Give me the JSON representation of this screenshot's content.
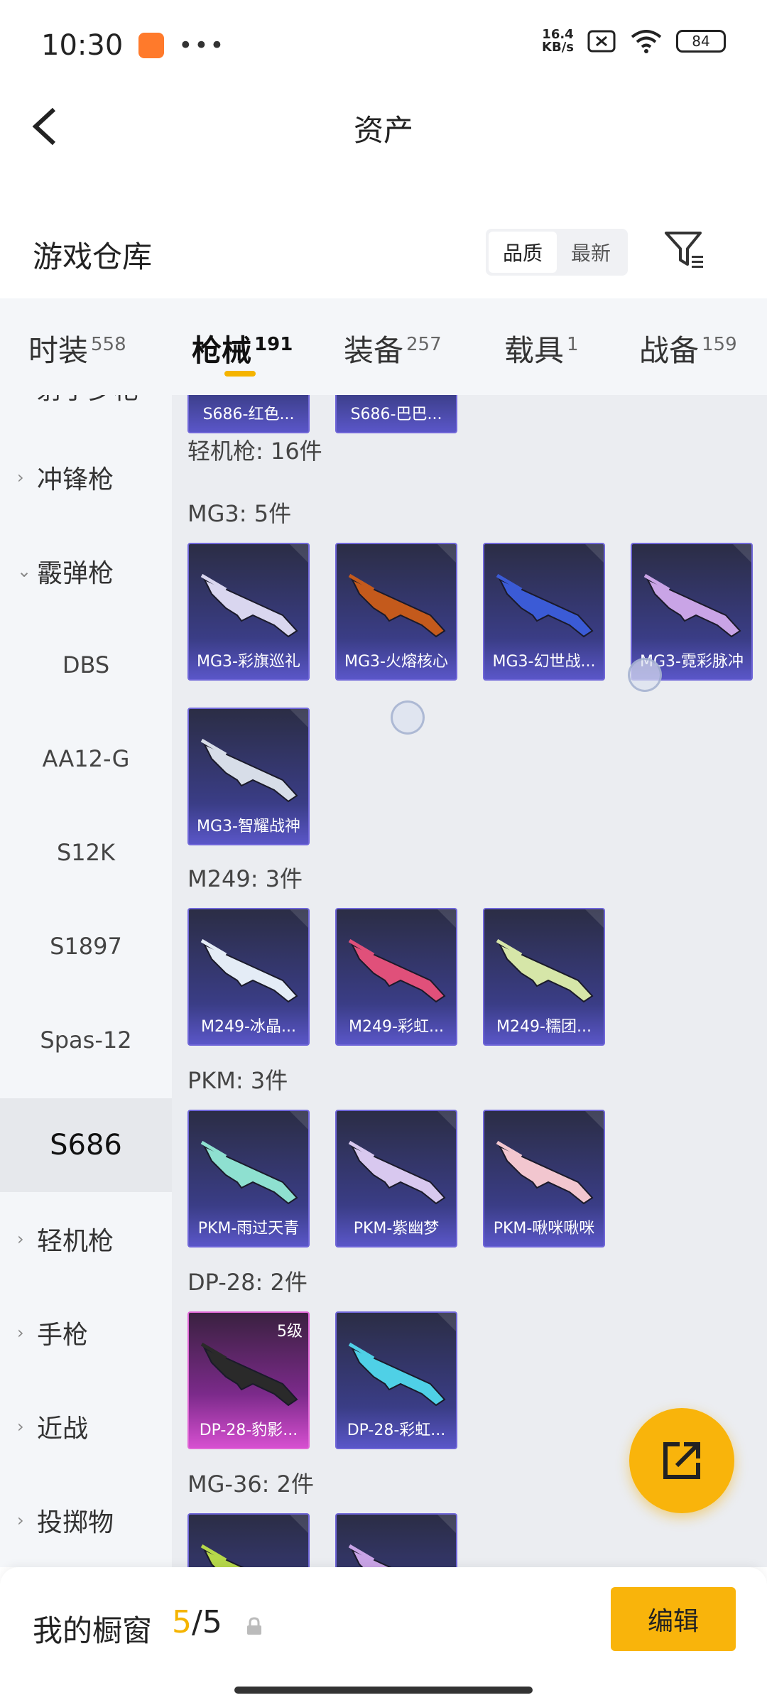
{
  "status": {
    "time": "10:30",
    "dots": "•••",
    "speed_top": "16.4",
    "speed_bottom": "KB/s",
    "battery": "84"
  },
  "header": {
    "title": "资产"
  },
  "section": {
    "title": "游戏仓库",
    "sort_options": [
      "品质",
      "最新"
    ],
    "sort_active": "品质"
  },
  "tabs": [
    {
      "label": "时装",
      "count": "558"
    },
    {
      "label": "枪械",
      "count": "191"
    },
    {
      "label": "装备",
      "count": "257"
    },
    {
      "label": "载具",
      "count": "1"
    },
    {
      "label": "战备",
      "count": "159"
    }
  ],
  "sidebar": {
    "items": [
      {
        "label": "射手步枪",
        "type": "category"
      },
      {
        "label": "冲锋枪",
        "type": "category"
      },
      {
        "label": "霰弹枪",
        "type": "category-open"
      },
      {
        "label": "DBS",
        "type": "sub"
      },
      {
        "label": "AA12-G",
        "type": "sub"
      },
      {
        "label": "S12K",
        "type": "sub"
      },
      {
        "label": "S1897",
        "type": "sub"
      },
      {
        "label": "Spas-12",
        "type": "sub"
      },
      {
        "label": "S686",
        "type": "selected"
      },
      {
        "label": "轻机枪",
        "type": "category"
      },
      {
        "label": "手枪",
        "type": "category"
      },
      {
        "label": "近战",
        "type": "category"
      },
      {
        "label": "投掷物",
        "type": "category"
      }
    ]
  },
  "content": {
    "top_cards": [
      "S686-红色...",
      "S686-巴巴..."
    ],
    "category_header": "轻机枪: 16件",
    "groups": [
      {
        "label": "MG3: 5件",
        "items": [
          {
            "name": "MG3-彩旗巡礼",
            "gun_color": "#d9d6ef"
          },
          {
            "name": "MG3-火熔核心",
            "gun_color": "#c45a1c"
          },
          {
            "name": "MG3-幻世战...",
            "gun_color": "#3b5bd6"
          },
          {
            "name": "MG3-霓彩脉冲",
            "gun_color": "#c9a4e6"
          },
          {
            "name": "MG3-智耀战神",
            "gun_color": "#d7dde8"
          }
        ]
      },
      {
        "label": "M249: 3件",
        "items": [
          {
            "name": "M249-冰晶...",
            "gun_color": "#e4ecf6"
          },
          {
            "name": "M249-彩虹...",
            "gun_color": "#e0507a"
          },
          {
            "name": "M249-糯团...",
            "gun_color": "#d6e6a8"
          }
        ]
      },
      {
        "label": "PKM: 3件",
        "items": [
          {
            "name": "PKM-雨过天青",
            "gun_color": "#8ee0d0"
          },
          {
            "name": "PKM-紫幽梦",
            "gun_color": "#d8c8ef"
          },
          {
            "name": "PKM-啾咪啾咪",
            "gun_color": "#f2c6cf"
          }
        ]
      },
      {
        "label": "DP-28: 2件",
        "items": [
          {
            "name": "DP-28-豹影...",
            "gun_color": "#2a2a2a",
            "badge": "5级",
            "rarity": "pink"
          },
          {
            "name": "DP-28-彩虹...",
            "gun_color": "#4fd0e6"
          }
        ]
      },
      {
        "label": "MG-36: 2件",
        "items": [
          {
            "name": "",
            "gun_color": "#b6d84a"
          },
          {
            "name": "",
            "gun_color": "#c9a4e6"
          }
        ]
      }
    ]
  },
  "bottom": {
    "showcase_label": "我的橱窗",
    "count_current": "5",
    "count_sep": "/",
    "count_total": "5",
    "edit_label": "编辑"
  },
  "colors": {
    "accent": "#f9b40b",
    "card_blue": "#3a3d86",
    "card_pink": "#d64fd0"
  }
}
